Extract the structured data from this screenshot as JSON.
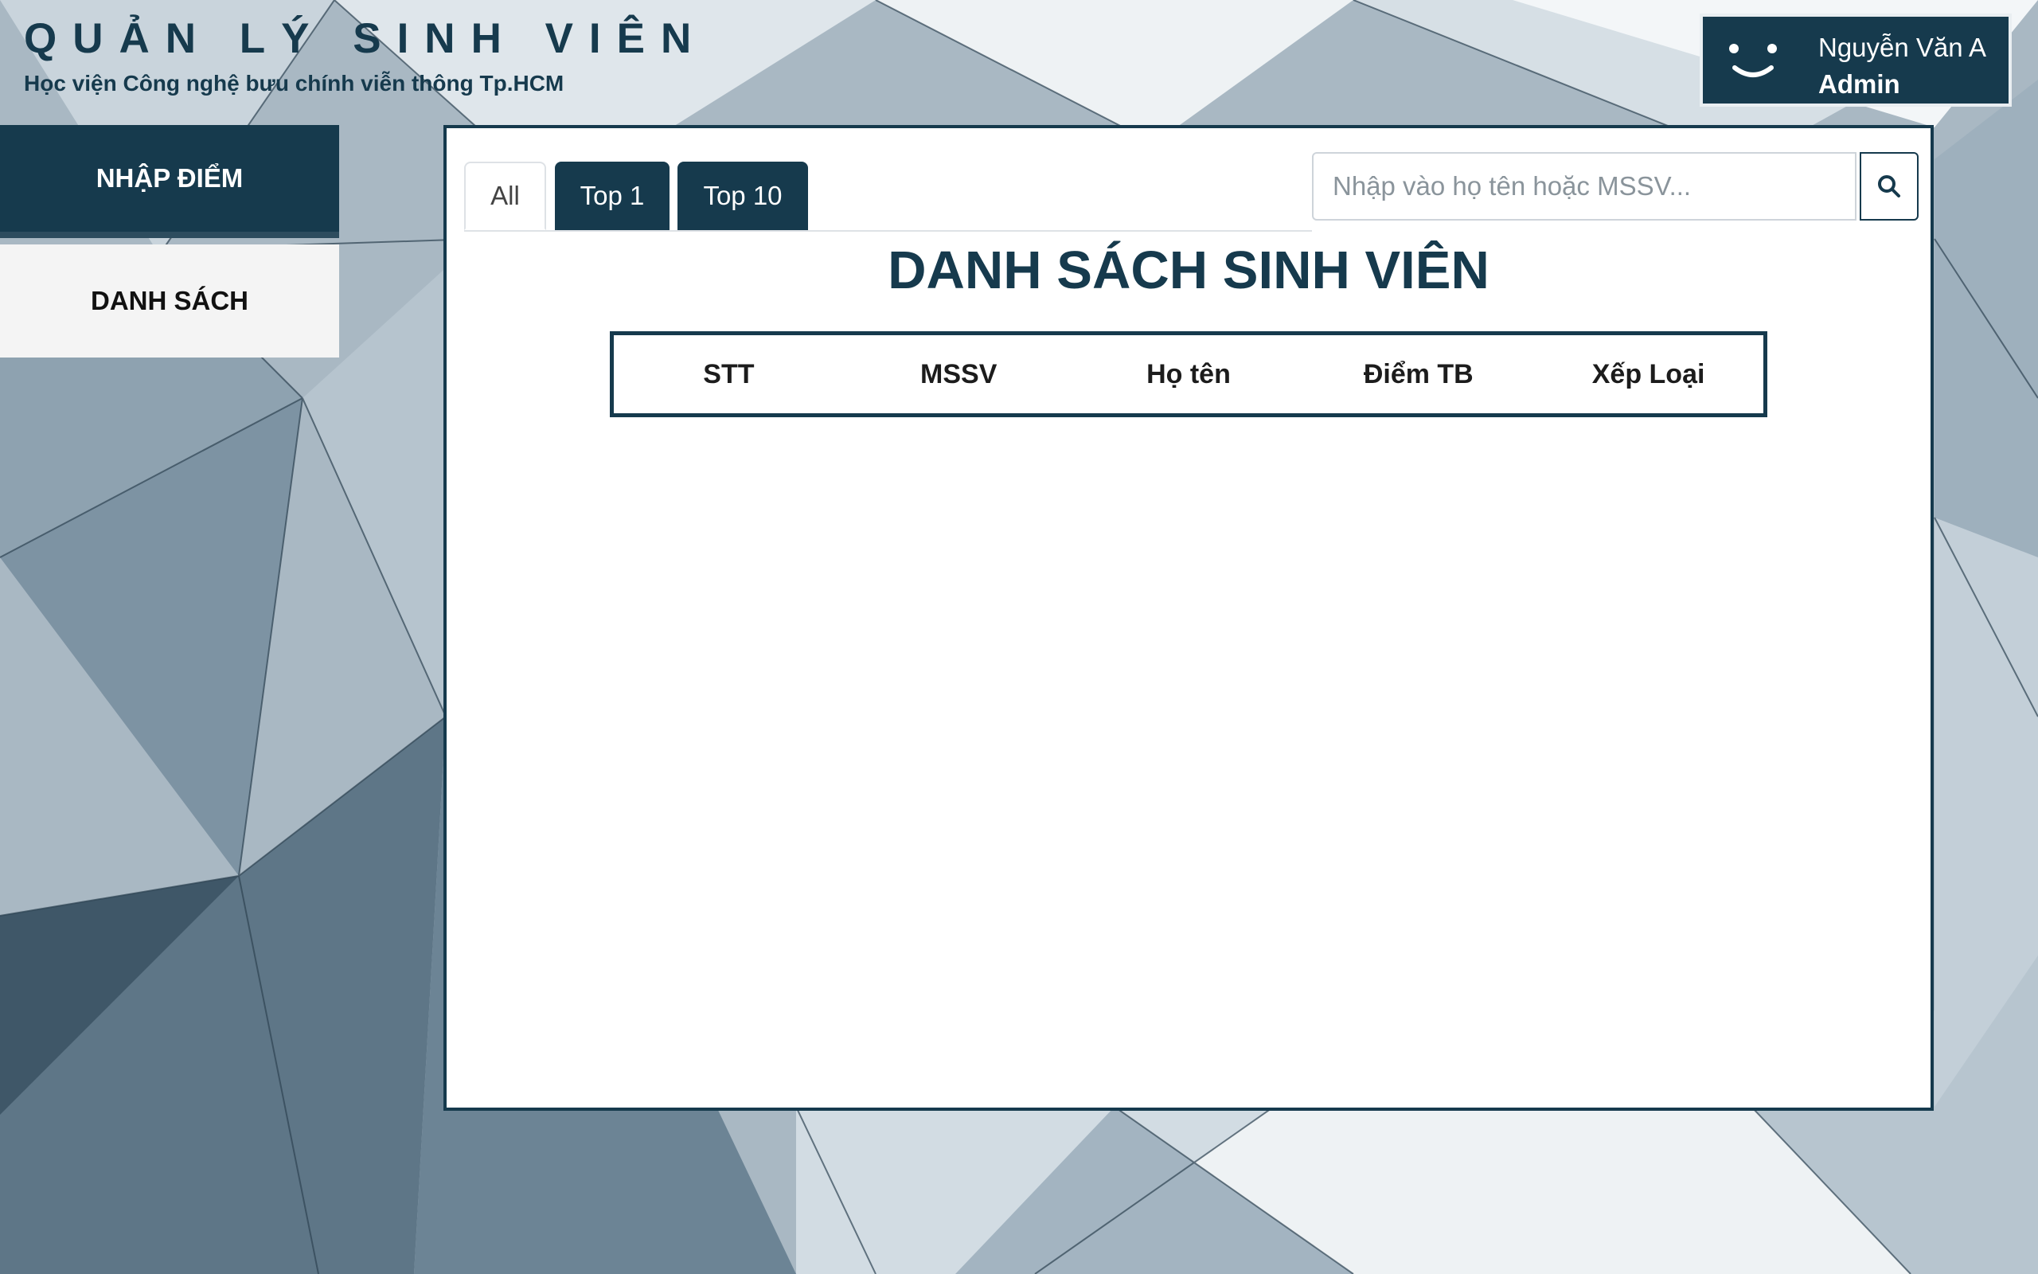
{
  "header": {
    "title": "QUẢN LÝ SINH VIÊN",
    "subtitle": "Học viện Công nghệ bưu chính viễn thông Tp.HCM"
  },
  "user": {
    "icon": "smiley-icon",
    "name": "Nguyễn Văn A",
    "role": "Admin"
  },
  "sidebar": {
    "items": [
      {
        "label": "NHẬP ĐIỂM",
        "active": true
      },
      {
        "label": "DANH SÁCH",
        "active": false
      }
    ]
  },
  "tabs": [
    {
      "label": "All",
      "active": true
    },
    {
      "label": "Top 1",
      "active": false
    },
    {
      "label": "Top 10",
      "active": false
    }
  ],
  "search": {
    "placeholder": "Nhập vào họ tên hoặc MSSV...",
    "value": "",
    "icon": "search-icon"
  },
  "main": {
    "title": "DANH SÁCH SINH VIÊN",
    "table": {
      "columns": [
        "STT",
        "MSSV",
        "Họ tên",
        "Điểm TB",
        "Xếp Loại"
      ],
      "rows": []
    }
  },
  "colors": {
    "primary": "#163a4d",
    "sidebar_inactive": "#f4f4f4",
    "panel_bg": "#ffffff"
  }
}
